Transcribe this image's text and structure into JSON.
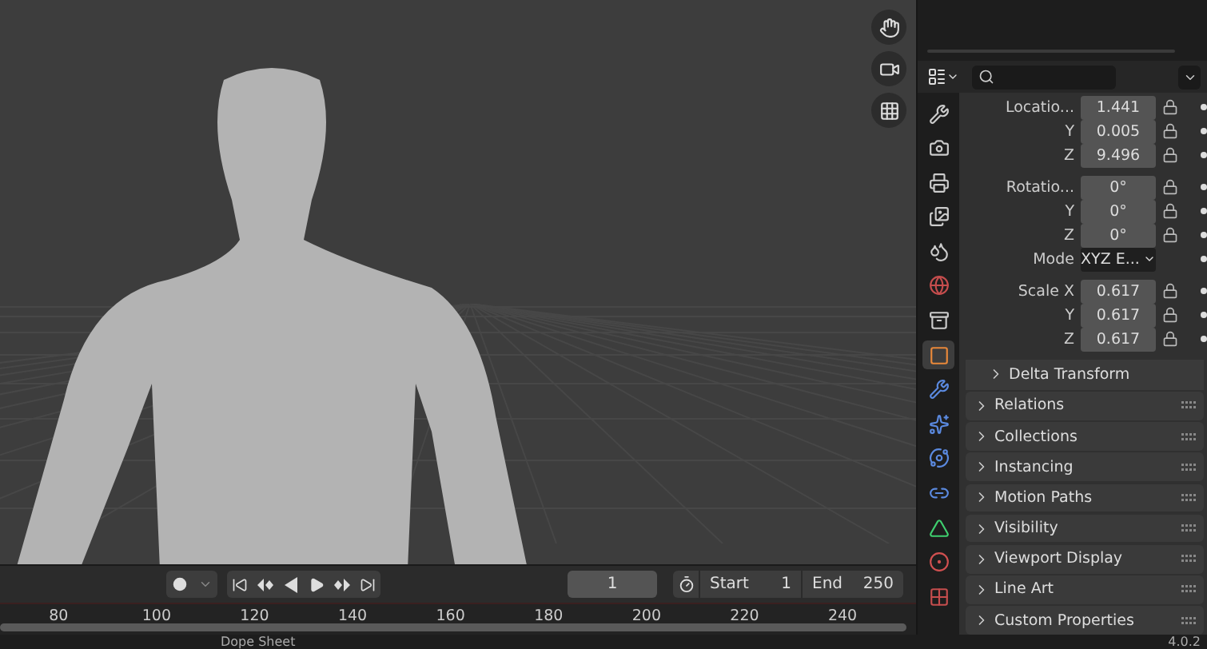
{
  "properties": {
    "tabs": [
      {
        "kind": "tool",
        "selected": false
      },
      {
        "kind": "render",
        "selected": false
      },
      {
        "kind": "output",
        "selected": false
      },
      {
        "kind": "view_layer",
        "selected": false
      },
      {
        "kind": "scene",
        "selected": false
      },
      {
        "kind": "world",
        "selected": false
      },
      {
        "kind": "collection",
        "selected": false
      },
      {
        "kind": "object",
        "selected": true
      },
      {
        "kind": "modifiers",
        "selected": false
      },
      {
        "kind": "particles",
        "selected": false
      },
      {
        "kind": "physics",
        "selected": false
      },
      {
        "kind": "constraints",
        "selected": false
      },
      {
        "kind": "data",
        "selected": false
      },
      {
        "kind": "material",
        "selected": false
      },
      {
        "kind": "texture",
        "selected": false
      }
    ],
    "transform": [
      [
        {
          "kind": "number",
          "label": "Locatio...",
          "value": "1.441"
        },
        {
          "kind": "number",
          "label": "Y",
          "value": "0.005"
        },
        {
          "kind": "number",
          "label": "Z",
          "value": "9.496"
        }
      ],
      [
        {
          "kind": "number",
          "label": "Rotatio...",
          "value": "0°"
        },
        {
          "kind": "number",
          "label": "Y",
          "value": "0°"
        },
        {
          "kind": "number",
          "label": "Z",
          "value": "0°"
        },
        {
          "kind": "dropdown",
          "label": "Mode",
          "value": "XYZ E..."
        }
      ],
      [
        {
          "kind": "number",
          "label": "Scale X",
          "value": "0.617"
        },
        {
          "kind": "number",
          "label": "Y",
          "value": "0.617"
        },
        {
          "kind": "number",
          "label": "Z",
          "value": "0.617"
        }
      ]
    ],
    "subpanel": {
      "label": "Delta Transform",
      "expanded": false
    },
    "panels": [
      {
        "label": "Relations",
        "expanded": false
      },
      {
        "label": "Collections",
        "expanded": false
      },
      {
        "label": "Instancing",
        "expanded": false
      },
      {
        "label": "Motion Paths",
        "expanded": false
      },
      {
        "label": "Visibility",
        "expanded": false
      },
      {
        "label": "Viewport Display",
        "expanded": false
      },
      {
        "label": "Line Art",
        "expanded": false
      },
      {
        "label": "Custom Properties",
        "expanded": false
      }
    ]
  },
  "timeline": {
    "current_frame": "1",
    "start_label": "Start",
    "start": "1",
    "end_label": "End",
    "end": "250",
    "ruler": [
      "80",
      "100",
      "120",
      "140",
      "160",
      "180",
      "200",
      "220",
      "240"
    ]
  },
  "status_bar": {
    "editor": "Dope Sheet",
    "version": "4.0.2"
  }
}
